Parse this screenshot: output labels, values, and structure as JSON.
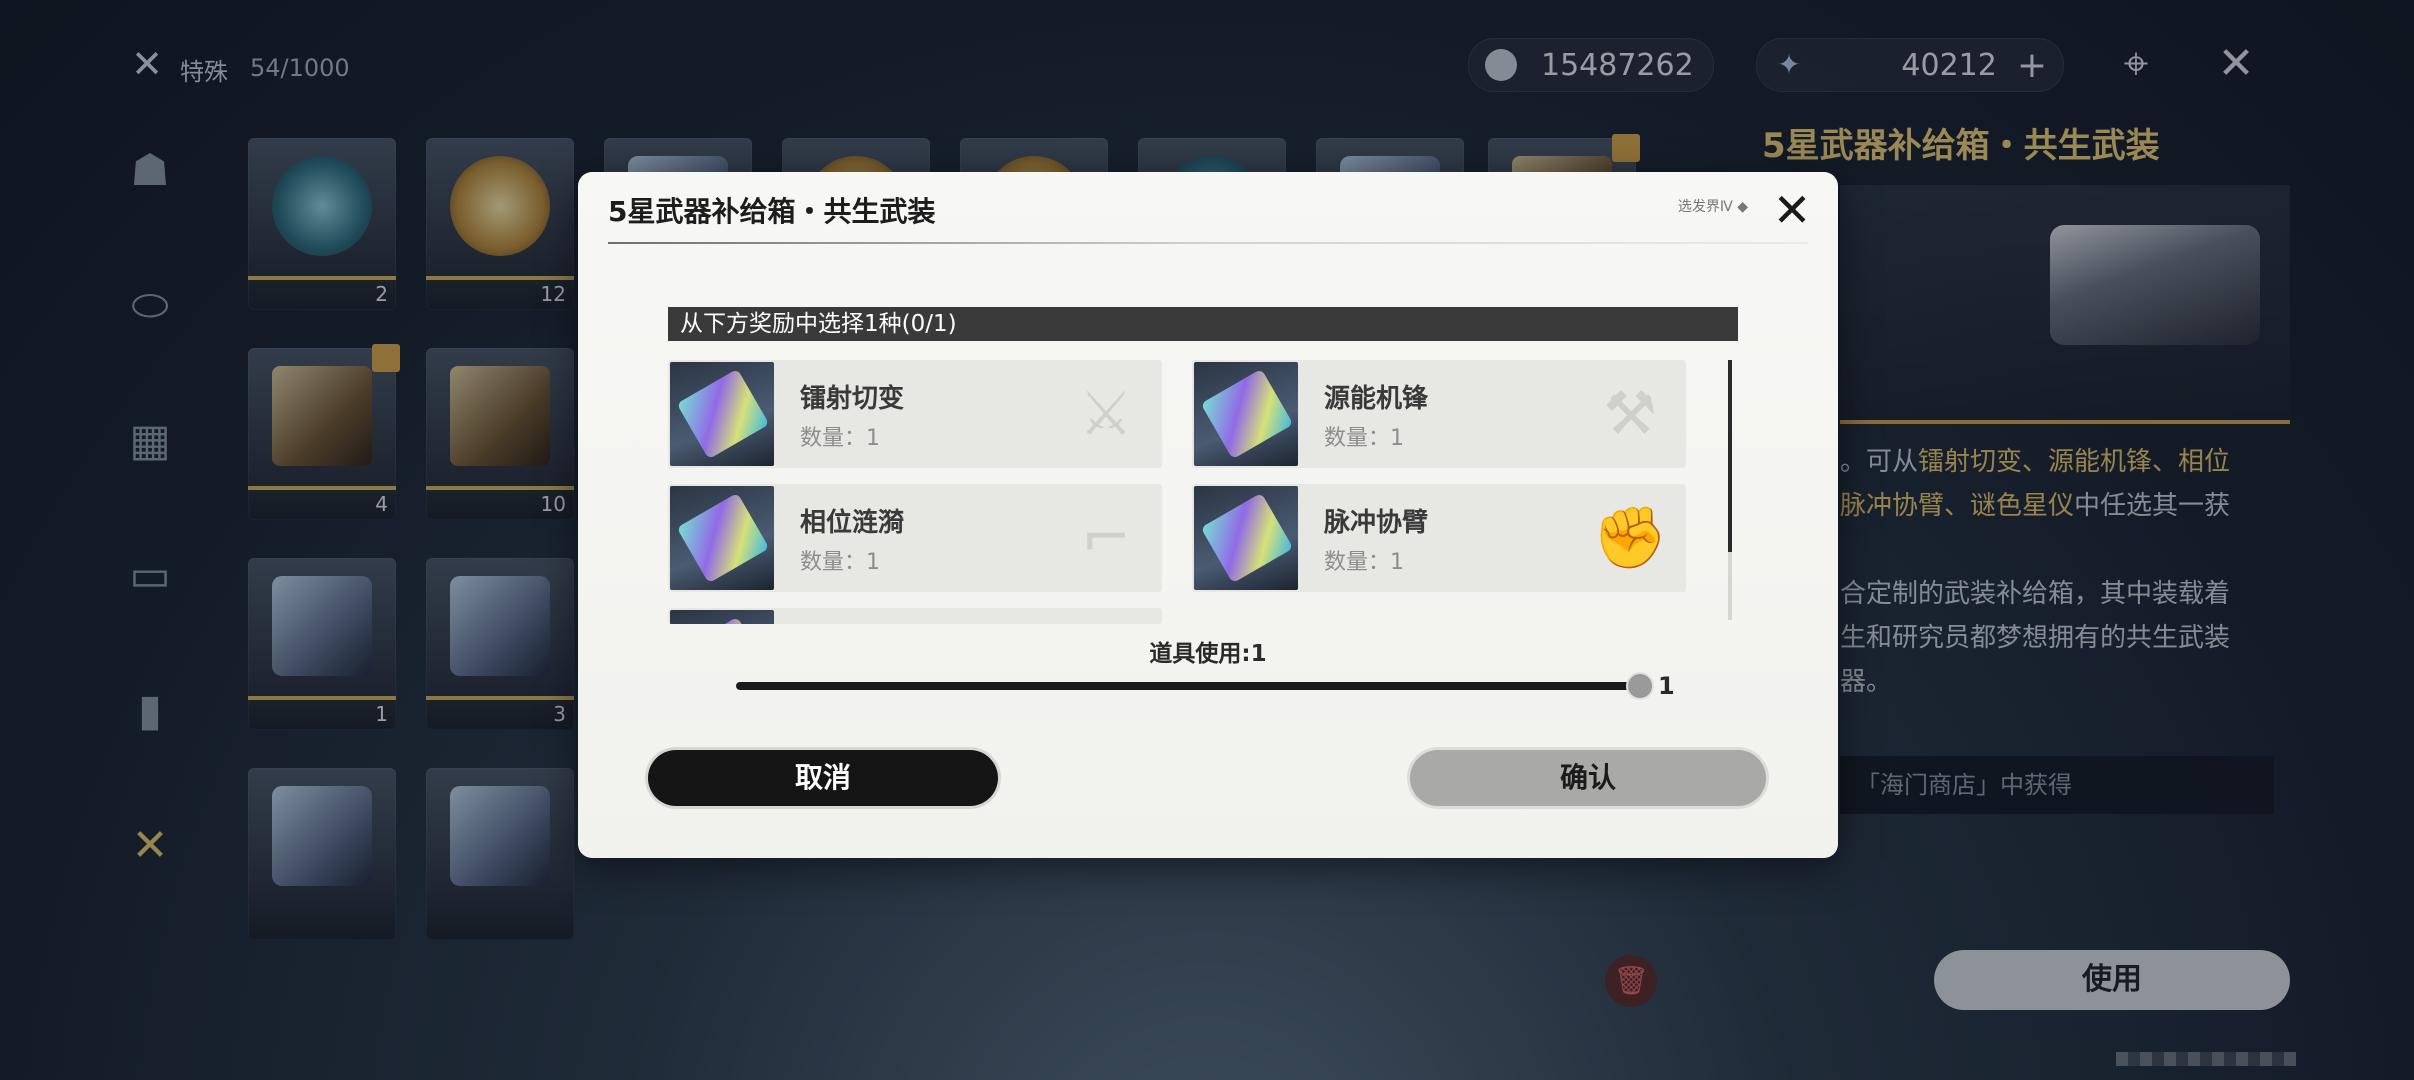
{
  "inventory": {
    "category_label": "特殊",
    "category_count": "54/1000",
    "slots": [
      {
        "qty": "2"
      },
      {
        "qty": "12"
      },
      {
        "qty": ""
      },
      {
        "qty": ""
      },
      {
        "qty": ""
      },
      {
        "qty": ""
      },
      {
        "qty": ""
      },
      {
        "qty": ""
      },
      {
        "qty": "4"
      },
      {
        "qty": "10"
      },
      {
        "qty": "1"
      },
      {
        "qty": "3"
      },
      {
        "qty": ""
      },
      {
        "qty": ""
      }
    ]
  },
  "currencies": {
    "primary_amount": "15487262",
    "secondary_amount": "40212",
    "add_label": "+"
  },
  "detail": {
    "title": "5星武器补给箱・共生武装",
    "description_prefix": "。可从",
    "description_highlight_1": "镭射切变、源能机锋、相位",
    "description_highlight_2": "脉冲协臂、谜色星仪",
    "description_suffix": "中任选其一获",
    "lore_1": "合定制的武装补给箱，其中装载着",
    "lore_2": "生和研究员都梦想拥有的共生武装",
    "lore_3": "器。",
    "source": "「海门商店」中获得",
    "use_button": "使用"
  },
  "modal": {
    "title": "5星武器补给箱・共生武装",
    "tag": "选发界Ⅳ ◆",
    "select_header": "从下方奖励中选择1种(0/1)",
    "rewards": [
      {
        "name": "镭射切变",
        "qty": "数量：1",
        "type_icon": "sword-icon"
      },
      {
        "name": "源能机锋",
        "qty": "数量：1",
        "type_icon": "blade-icon"
      },
      {
        "name": "相位涟漪",
        "qty": "数量：1",
        "type_icon": "pistol-icon"
      },
      {
        "name": "脉冲协臂",
        "qty": "数量：1",
        "type_icon": "gauntlet-icon"
      }
    ],
    "use_count_label": "道具使用:1",
    "slider_value": "1",
    "slider_fraction": 1.0,
    "cancel_label": "取消",
    "confirm_label": "确认"
  },
  "colors": {
    "gold_accent": "#e6c46a",
    "cancel_bg": "#151515",
    "confirm_bg": "#a9a9a7"
  }
}
